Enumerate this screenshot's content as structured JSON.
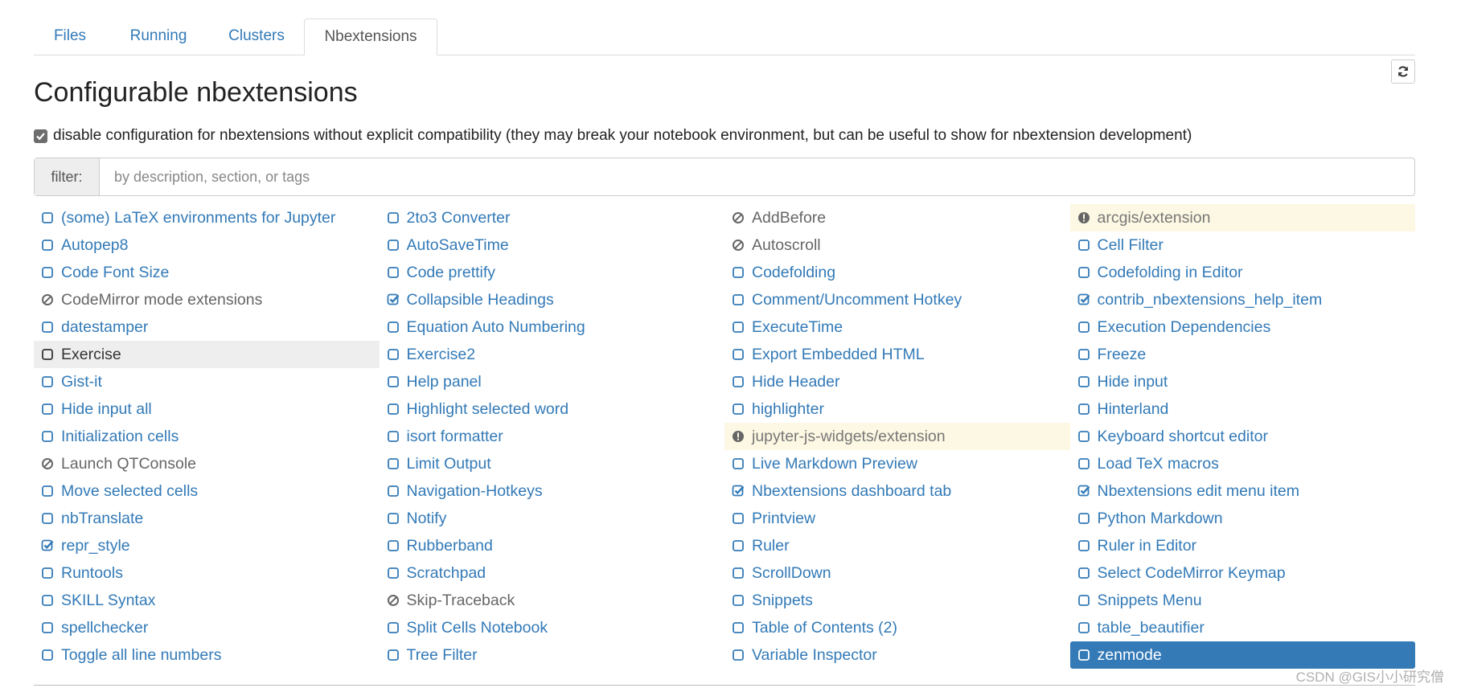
{
  "tabs": [
    {
      "label": "Files",
      "active": false
    },
    {
      "label": "Running",
      "active": false
    },
    {
      "label": "Clusters",
      "active": false
    },
    {
      "label": "Nbextensions",
      "active": true
    }
  ],
  "refresh_icon": "refresh-icon",
  "page_title": "Configurable nbextensions",
  "compat_checkbox": {
    "checked": true,
    "label": "disable configuration for nbextensions without explicit compatibility (they may break your notebook environment, but can be useful to show for nbextension development)"
  },
  "filter": {
    "label": "filter:",
    "placeholder": "by description, section, or tags",
    "value": ""
  },
  "colors": {
    "link": "#337ab7",
    "disabled_text": "#666666",
    "warning_bg": "#fcf8e3",
    "selected_bg": "#337ab7",
    "hover_bg": "#eeeeee"
  },
  "extensions": [
    {
      "label": "(some) LaTeX environments for Jupyter",
      "state": "unchecked"
    },
    {
      "label": "2to3 Converter",
      "state": "unchecked"
    },
    {
      "label": "AddBefore",
      "state": "unconfigurable"
    },
    {
      "label": "arcgis/extension",
      "state": "warning"
    },
    {
      "label": "Autopep8",
      "state": "unchecked"
    },
    {
      "label": "AutoSaveTime",
      "state": "unchecked"
    },
    {
      "label": "Autoscroll",
      "state": "unconfigurable"
    },
    {
      "label": "Cell Filter",
      "state": "unchecked"
    },
    {
      "label": "Code Font Size",
      "state": "unchecked"
    },
    {
      "label": "Code prettify",
      "state": "unchecked"
    },
    {
      "label": "Codefolding",
      "state": "unchecked"
    },
    {
      "label": "Codefolding in Editor",
      "state": "unchecked"
    },
    {
      "label": "CodeMirror mode extensions",
      "state": "unconfigurable"
    },
    {
      "label": "Collapsible Headings",
      "state": "checked"
    },
    {
      "label": "Comment/Uncomment Hotkey",
      "state": "unchecked"
    },
    {
      "label": "contrib_nbextensions_help_item",
      "state": "checked"
    },
    {
      "label": "datestamper",
      "state": "unchecked"
    },
    {
      "label": "Equation Auto Numbering",
      "state": "unchecked"
    },
    {
      "label": "ExecuteTime",
      "state": "unchecked"
    },
    {
      "label": "Execution Dependencies",
      "state": "unchecked"
    },
    {
      "label": "Exercise",
      "state": "unchecked",
      "row_style": "hovered"
    },
    {
      "label": "Exercise2",
      "state": "unchecked"
    },
    {
      "label": "Export Embedded HTML",
      "state": "unchecked"
    },
    {
      "label": "Freeze",
      "state": "unchecked"
    },
    {
      "label": "Gist-it",
      "state": "unchecked"
    },
    {
      "label": "Help panel",
      "state": "unchecked"
    },
    {
      "label": "Hide Header",
      "state": "unchecked"
    },
    {
      "label": "Hide input",
      "state": "unchecked"
    },
    {
      "label": "Hide input all",
      "state": "unchecked"
    },
    {
      "label": "Highlight selected word",
      "state": "unchecked"
    },
    {
      "label": "highlighter",
      "state": "unchecked"
    },
    {
      "label": "Hinterland",
      "state": "unchecked"
    },
    {
      "label": "Initialization cells",
      "state": "unchecked"
    },
    {
      "label": "isort formatter",
      "state": "unchecked"
    },
    {
      "label": "jupyter-js-widgets/extension",
      "state": "warning"
    },
    {
      "label": "Keyboard shortcut editor",
      "state": "unchecked"
    },
    {
      "label": "Launch QTConsole",
      "state": "unconfigurable"
    },
    {
      "label": "Limit Output",
      "state": "unchecked"
    },
    {
      "label": "Live Markdown Preview",
      "state": "unchecked"
    },
    {
      "label": "Load TeX macros",
      "state": "unchecked"
    },
    {
      "label": "Move selected cells",
      "state": "unchecked"
    },
    {
      "label": "Navigation-Hotkeys",
      "state": "unchecked"
    },
    {
      "label": "Nbextensions dashboard tab",
      "state": "checked"
    },
    {
      "label": "Nbextensions edit menu item",
      "state": "checked"
    },
    {
      "label": "nbTranslate",
      "state": "unchecked"
    },
    {
      "label": "Notify",
      "state": "unchecked"
    },
    {
      "label": "Printview",
      "state": "unchecked"
    },
    {
      "label": "Python Markdown",
      "state": "unchecked"
    },
    {
      "label": "repr_style",
      "state": "checked"
    },
    {
      "label": "Rubberband",
      "state": "unchecked"
    },
    {
      "label": "Ruler",
      "state": "unchecked"
    },
    {
      "label": "Ruler in Editor",
      "state": "unchecked"
    },
    {
      "label": "Runtools",
      "state": "unchecked"
    },
    {
      "label": "Scratchpad",
      "state": "unchecked"
    },
    {
      "label": "ScrollDown",
      "state": "unchecked"
    },
    {
      "label": "Select CodeMirror Keymap",
      "state": "unchecked"
    },
    {
      "label": "SKILL Syntax",
      "state": "unchecked"
    },
    {
      "label": "Skip-Traceback",
      "state": "unconfigurable"
    },
    {
      "label": "Snippets",
      "state": "unchecked"
    },
    {
      "label": "Snippets Menu",
      "state": "unchecked"
    },
    {
      "label": "spellchecker",
      "state": "unchecked"
    },
    {
      "label": "Split Cells Notebook",
      "state": "unchecked"
    },
    {
      "label": "Table of Contents (2)",
      "state": "unchecked"
    },
    {
      "label": "table_beautifier",
      "state": "unchecked"
    },
    {
      "label": "Toggle all line numbers",
      "state": "unchecked"
    },
    {
      "label": "Tree Filter",
      "state": "unchecked"
    },
    {
      "label": "Variable Inspector",
      "state": "unchecked"
    },
    {
      "label": "zenmode",
      "state": "unchecked",
      "row_style": "selected"
    }
  ],
  "watermark": "CSDN @GIS小小研究僧"
}
